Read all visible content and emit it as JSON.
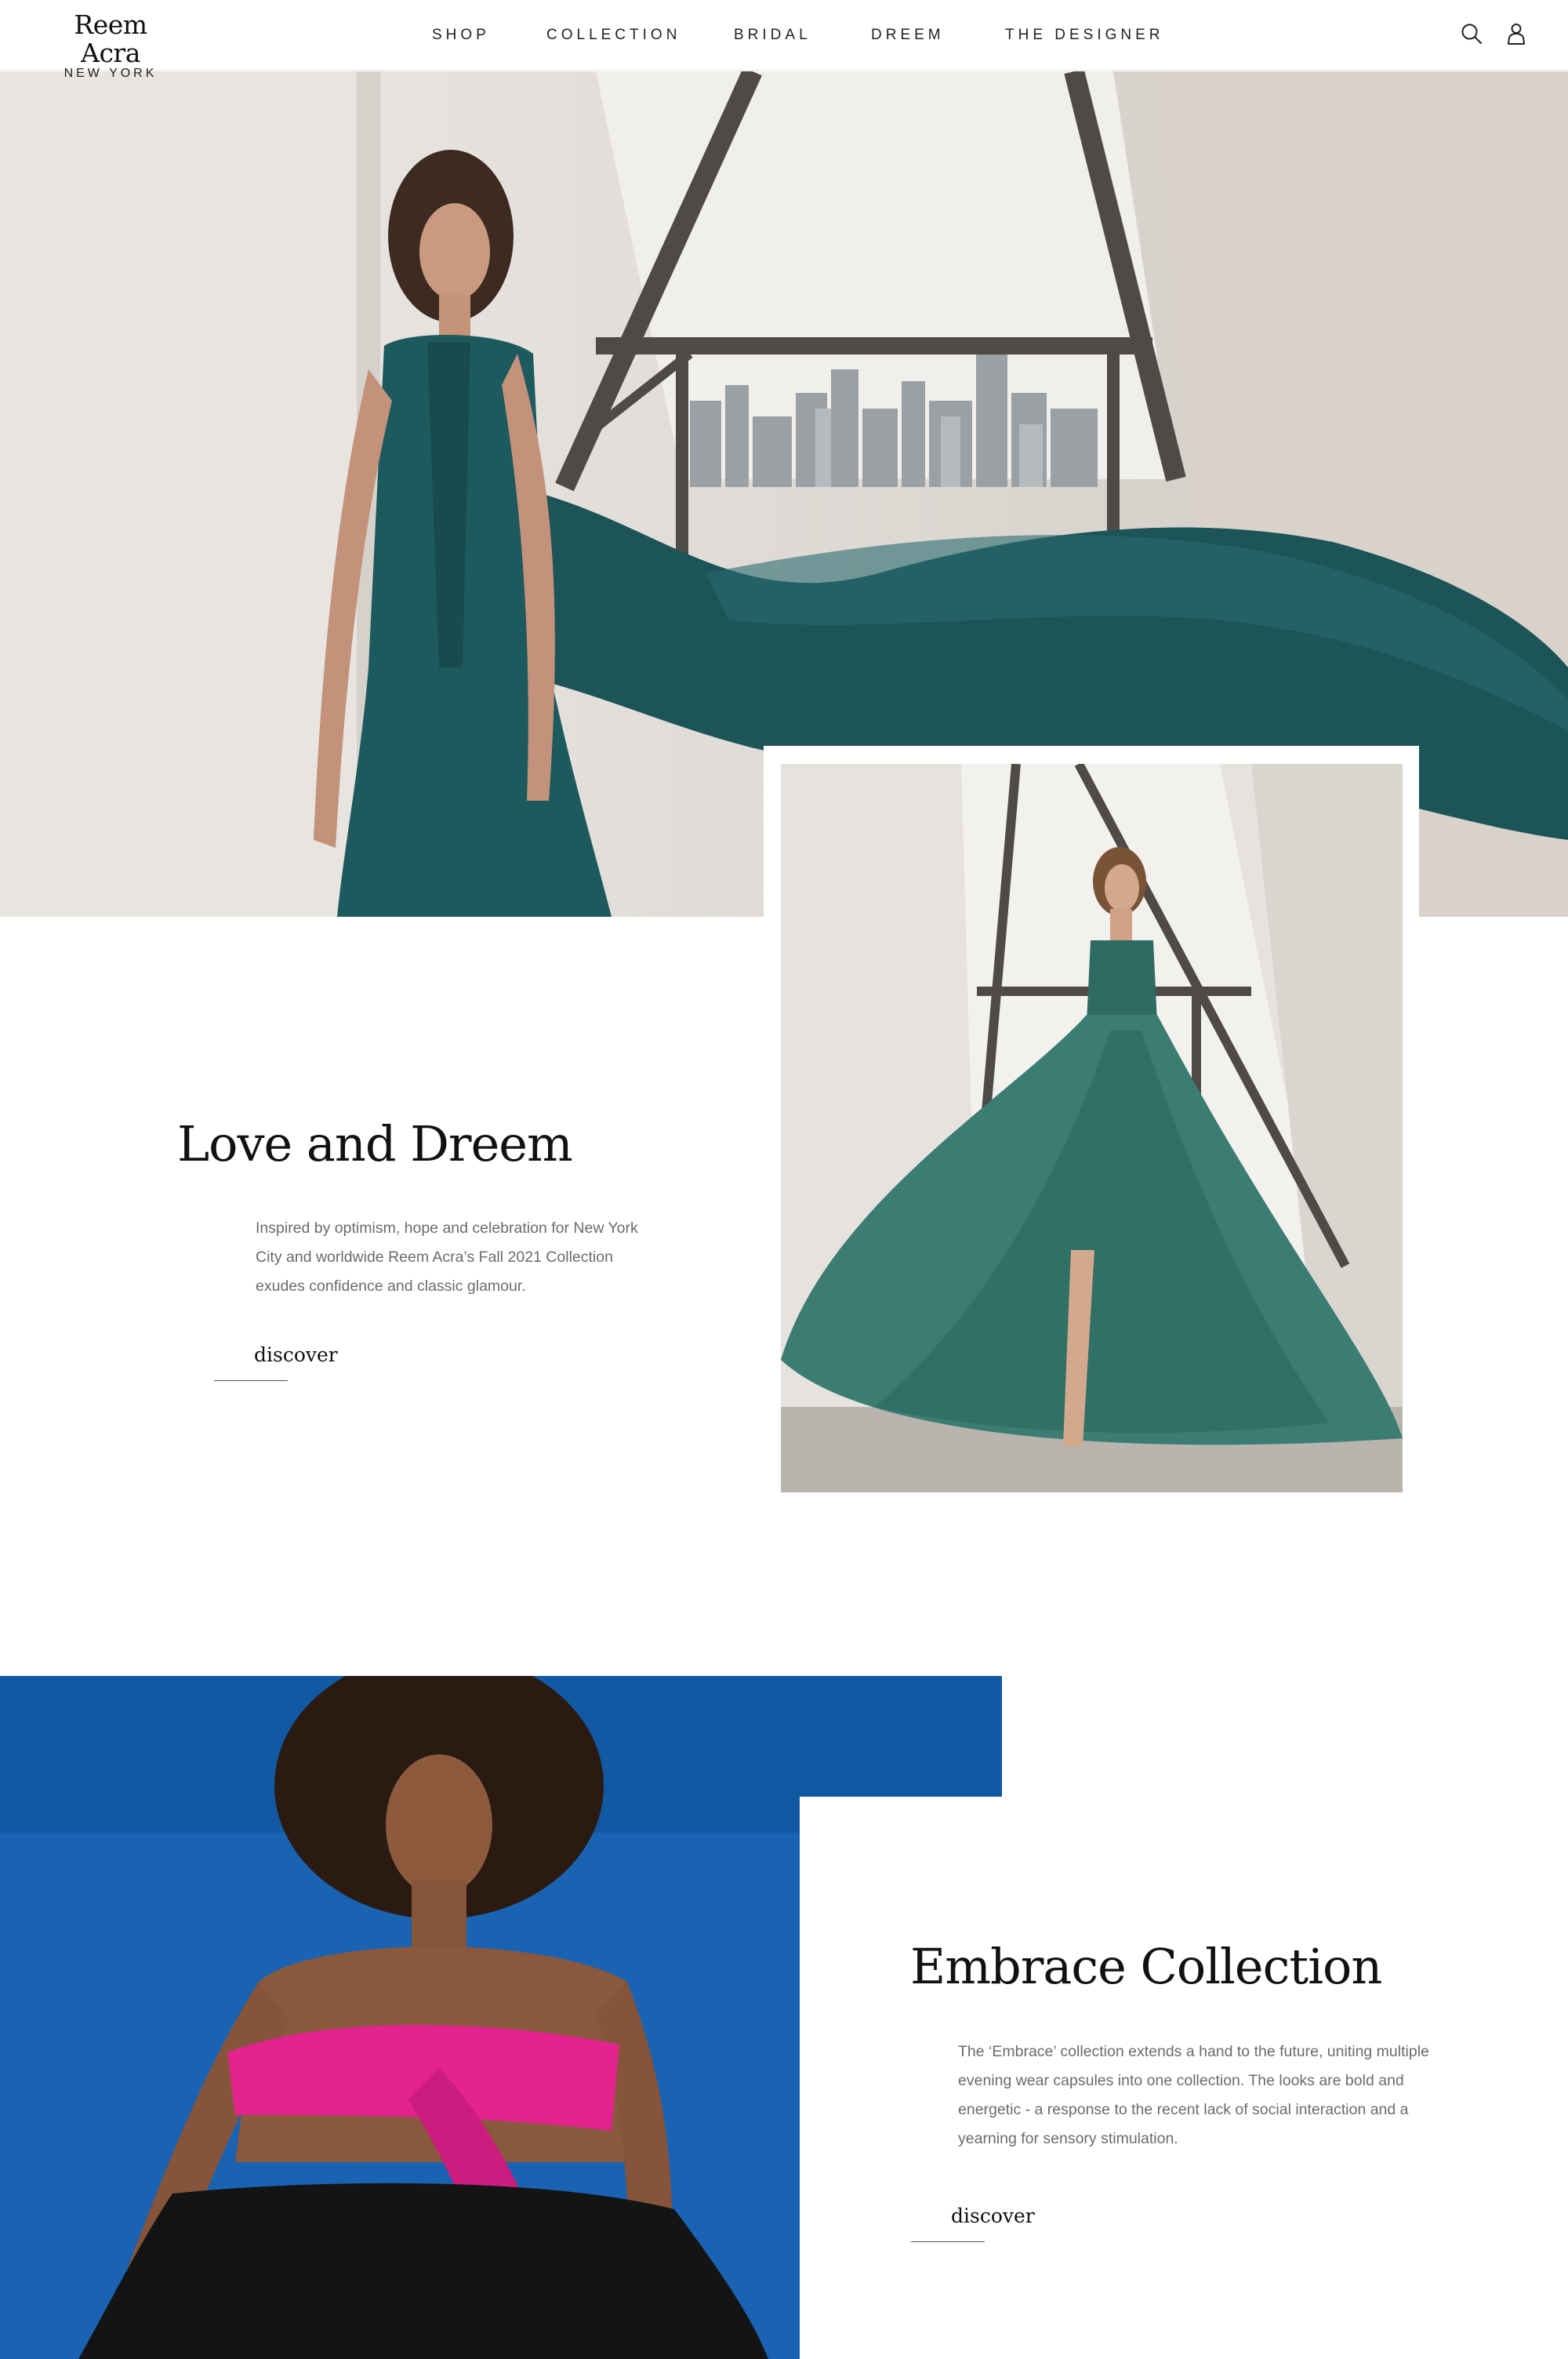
{
  "header": {
    "logo": {
      "name": "Reem Acra",
      "subtitle": "NEW YORK"
    },
    "nav": [
      "SHOP",
      "COLLECTION",
      "BRIDAL",
      "DREEM",
      "THE DESIGNER"
    ],
    "icons": [
      "search-icon",
      "account-icon"
    ]
  },
  "hero": {
    "image": "model in flowing teal chiffon gown before a city-view window"
  },
  "section1": {
    "title": "Love and Dreem",
    "body": "Inspired by optimism, hope and celebration for New York City and worldwide Reem Acra’s Fall 2021 Collection exudes confidence and classic glamour.",
    "link": "discover",
    "image": "model in teal tulle high-low ball gown by a window"
  },
  "section2": {
    "title": "Embrace Collection",
    "body": "The ‘Embrace’ collection extends a hand to the future, uniting multiple evening wear capsules into one collection. The looks are bold and energetic - a response to the recent lack of social interaction and a yearning for sensory stimulation.",
    "link": "discover",
    "image": "model in pink strapless bow top and black skirt on blue background"
  },
  "colors": {
    "teal": "#1d5a5e",
    "blue_background": "#1b63b3",
    "pink": "#e3248f",
    "text_gray": "#6b6b6b"
  }
}
